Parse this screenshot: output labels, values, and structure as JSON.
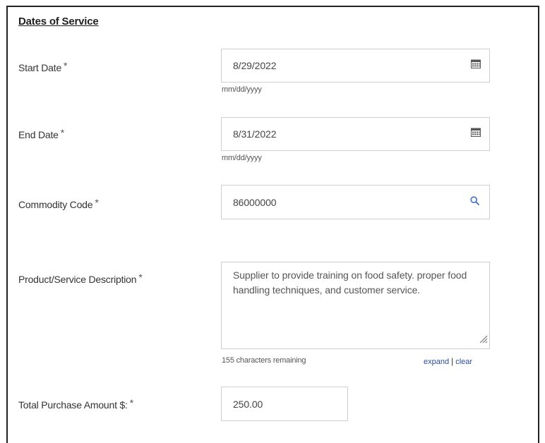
{
  "section": {
    "title": "Dates of Service"
  },
  "required_marker": "*",
  "start_date": {
    "label": "Start Date",
    "value": "8/29/2022",
    "hint": "mm/dd/yyyy",
    "icon": "calendar-icon"
  },
  "end_date": {
    "label": "End Date",
    "value": "8/31/2022",
    "hint": "mm/dd/yyyy",
    "icon": "calendar-icon"
  },
  "commodity_code": {
    "label": "Commodity Code",
    "value": "86000000",
    "icon": "search-icon"
  },
  "description": {
    "label": "Product/Service Description",
    "value": "Supplier to provide training on food safety. proper food handling techniques, and customer service.",
    "remaining": "155 characters remaining",
    "expand_label": "expand",
    "separator": "|",
    "clear_label": "clear"
  },
  "total_amount": {
    "label": "Total Purchase Amount $:",
    "value": "250.00"
  },
  "colors": {
    "link": "#2b4d9a",
    "search_icon": "#3b6fc6",
    "border": "#cfcfcf"
  }
}
